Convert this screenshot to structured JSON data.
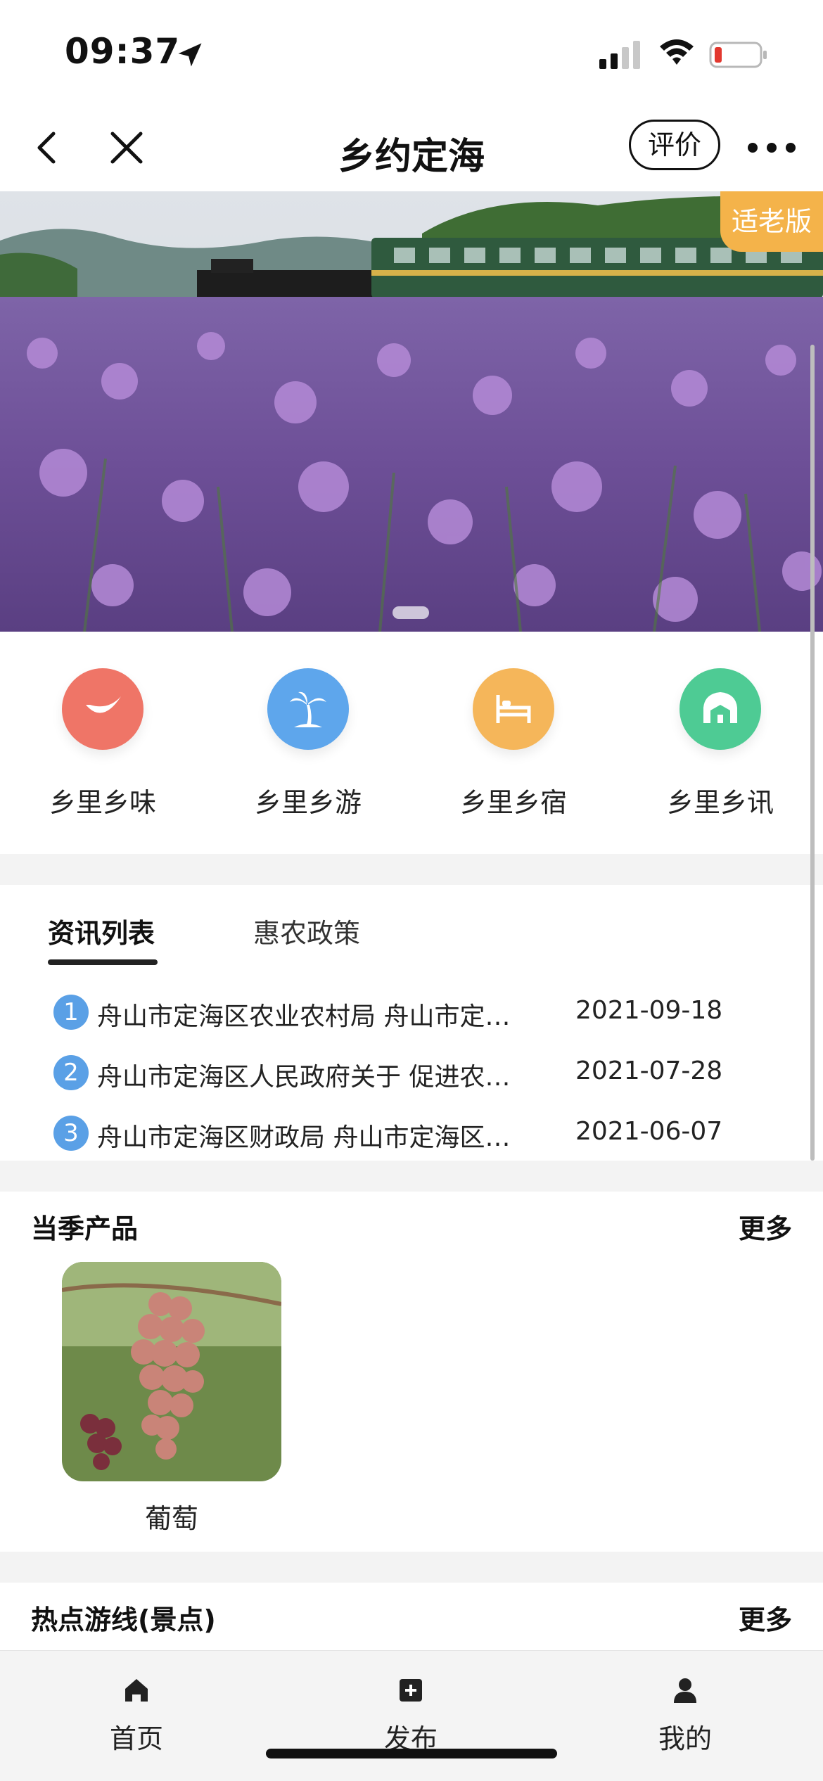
{
  "status_bar": {
    "time": "09:37"
  },
  "nav": {
    "title": "乡约定海",
    "rate_label": "评价"
  },
  "banner": {
    "badge": "适老版"
  },
  "categories": [
    {
      "label": "乡里乡味",
      "icon": "chili-icon",
      "color": "#ef7567"
    },
    {
      "label": "乡里乡游",
      "icon": "palm-tree-icon",
      "color": "#5ea6ec"
    },
    {
      "label": "乡里乡宿",
      "icon": "bed-icon",
      "color": "#f5b65a"
    },
    {
      "label": "乡里乡讯",
      "icon": "house-icon",
      "color": "#4ecb94"
    }
  ],
  "news": {
    "tabs": [
      "资讯列表",
      "惠农政策"
    ],
    "items": [
      {
        "num": "1",
        "title": "舟山市定海区农业农村局 舟山市定…",
        "date": "2021-09-18"
      },
      {
        "num": "2",
        "title": "舟山市定海区人民政府关于 促进农…",
        "date": "2021-07-28"
      },
      {
        "num": "3",
        "title": "舟山市定海区财政局 舟山市定海区…",
        "date": "2021-06-07"
      }
    ]
  },
  "products": {
    "title": "当季产品",
    "more": "更多",
    "items": [
      {
        "name": "葡萄"
      }
    ]
  },
  "routes": {
    "title": "热点游线(景点)",
    "more": "更多"
  },
  "tab_bar": {
    "home": "首页",
    "publish": "发布",
    "mine": "我的"
  },
  "colors": {
    "accent_badge": "#f4b34a",
    "news_number": "#5aa0e6"
  }
}
